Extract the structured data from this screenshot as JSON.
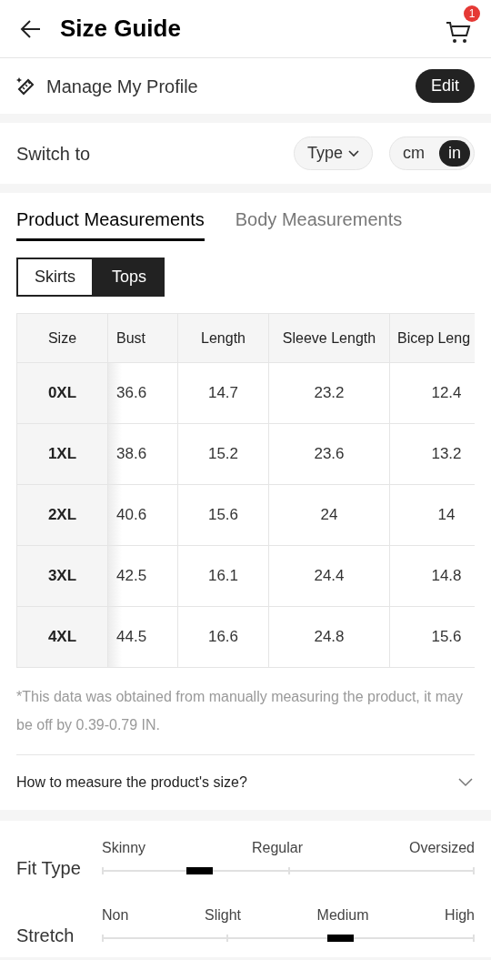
{
  "header": {
    "title": "Size Guide",
    "cart_count": "1"
  },
  "profile": {
    "label": "Manage My Profile",
    "button": "Edit"
  },
  "switch": {
    "label": "Switch to",
    "type_button": "Type",
    "units": [
      {
        "label": "cm",
        "selected": false
      },
      {
        "label": "in",
        "selected": true
      }
    ]
  },
  "tabs": [
    {
      "label": "Product Measurements",
      "selected": true
    },
    {
      "label": "Body Measurements",
      "selected": false
    }
  ],
  "categories": [
    {
      "label": "Skirts",
      "selected": false
    },
    {
      "label": "Tops",
      "selected": true
    }
  ],
  "table": {
    "columns": [
      "Size",
      "Bust",
      "Length",
      "Sleeve Length",
      "Bicep Leng"
    ],
    "rows": [
      [
        "0XL",
        "36.6",
        "14.7",
        "23.2",
        "12.4"
      ],
      [
        "1XL",
        "38.6",
        "15.2",
        "23.6",
        "13.2"
      ],
      [
        "2XL",
        "40.6",
        "15.6",
        "24",
        "14"
      ],
      [
        "3XL",
        "42.5",
        "16.1",
        "24.4",
        "14.8"
      ],
      [
        "4XL",
        "44.5",
        "16.6",
        "24.8",
        "15.6"
      ]
    ]
  },
  "note": "*This data was obtained from manually measuring the product, it may be off by 0.39-0.79 IN.",
  "how_to": {
    "label": "How to measure the product's size?",
    "expanded": false
  },
  "scales": [
    {
      "name": "Fit Type",
      "labels": [
        "Skinny",
        "Regular",
        "Oversized"
      ],
      "level": 0.26
    },
    {
      "name": "Stretch",
      "labels": [
        "Non",
        "Slight",
        "Medium",
        "High"
      ],
      "level": 0.64
    }
  ]
}
